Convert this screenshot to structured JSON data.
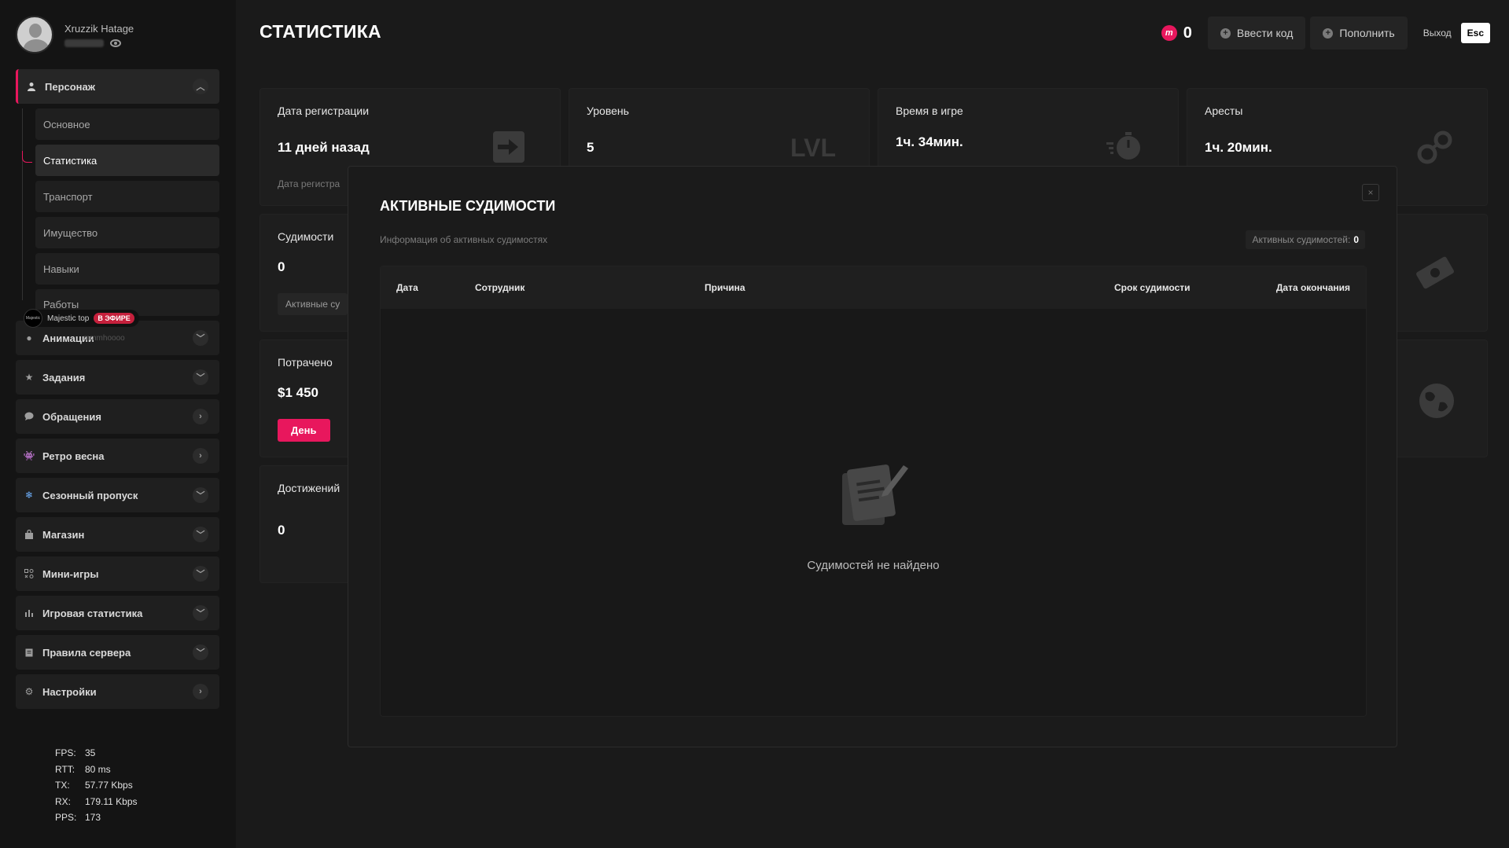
{
  "profile": {
    "name": "Xruzzik Hatage"
  },
  "sidebar": {
    "items": [
      {
        "label": "Персонаж",
        "expanded": true
      },
      {
        "label": "Анимации"
      },
      {
        "label": "Задания"
      },
      {
        "label": "Обращения"
      },
      {
        "label": "Ретро весна"
      },
      {
        "label": "Сезонный пропуск"
      },
      {
        "label": "Магазин"
      },
      {
        "label": "Мини-игры"
      },
      {
        "label": "Игровая статистика"
      },
      {
        "label": "Правила сервера"
      },
      {
        "label": "Настройки"
      }
    ],
    "submenu": [
      "Основное",
      "Статистика",
      "Транспорт",
      "Имущество",
      "Навыки",
      "Работы"
    ],
    "active_sub": "Статистика",
    "stream": {
      "logo": "Majestic",
      "title": "Majestic top",
      "live": "В ЭФИРЕ",
      "user": "mmmhoooo"
    }
  },
  "net": {
    "fps_k": "FPS:",
    "fps": "35",
    "rtt_k": "RTT:",
    "rtt": "80 ms",
    "tx_k": "TX:",
    "tx": "57.77 Kbps",
    "rx_k": "RX:",
    "rx": "179.11 Kbps",
    "pps_k": "PPS:",
    "pps": "173"
  },
  "header": {
    "title": "СТАТИСТИКА",
    "coins": "0",
    "coin_glyph": "m",
    "enter_code": "Ввести код",
    "top_up": "Пополнить",
    "exit": "Выход",
    "esc": "Esc"
  },
  "cards": {
    "reg": {
      "label": "Дата регистрации",
      "value": "11 дней назад",
      "sub": "Дата регистра"
    },
    "level": {
      "label": "Уровень",
      "value": "5",
      "icon_text": "LVL"
    },
    "time": {
      "label": "Время в игре",
      "value": "1ч. 34мин."
    },
    "arrests": {
      "label": "Аресты",
      "value": "1ч. 20мин."
    },
    "convictions": {
      "label": "Судимости",
      "value": "0",
      "pill": "Активные су"
    },
    "spent": {
      "label": "Потрачено",
      "value": "$1 450",
      "button": "День"
    },
    "achievements": {
      "label": "Достижений",
      "value": "0"
    }
  },
  "modal": {
    "title": "АКТИВНЫЕ СУДИМОСТИ",
    "subtitle": "Информация об активных судимостях",
    "count_label": "Активных судимостей:",
    "count": "0",
    "close": "×",
    "columns": [
      "Дата",
      "Сотрудник",
      "Причина",
      "Срок судимости",
      "Дата окончания"
    ],
    "empty": "Судимостей не найдено"
  }
}
